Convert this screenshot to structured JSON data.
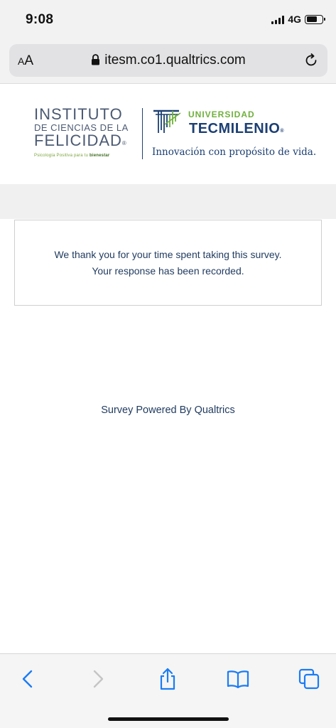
{
  "status_bar": {
    "time": "9:08",
    "network": "4G",
    "signal_bars_active": 4,
    "battery_level": 0.7
  },
  "address_bar": {
    "text_size_button": "AA",
    "url": "itesm.co1.qualtrics.com",
    "icons": [
      "lock-icon",
      "reload-icon"
    ]
  },
  "header": {
    "left_logo": {
      "line1": "INSTITUTO",
      "line2": "DE CIENCIAS DE LA",
      "line3": "FELICIDAD",
      "registered": "®",
      "subtitle_prefix": "Psicología Positiva para tu ",
      "subtitle_highlight": "bienestar"
    },
    "right_logo": {
      "university": "UNIVERSIDAD",
      "name": "TECMILENIO",
      "registered": "®",
      "tagline": "Innovación con propósito de vida."
    }
  },
  "survey": {
    "thanks_line1": "We thank you for your time spent taking this survey.",
    "thanks_line2": "Your response has been recorded.",
    "powered_by": "Survey Powered By Qualtrics"
  },
  "toolbar": {
    "items": [
      "back-icon",
      "forward-icon",
      "share-icon",
      "bookmarks-icon",
      "tabs-icon"
    ]
  },
  "colors": {
    "accent_blue": "#1a7cf5",
    "tec_navy": "#1c3f73",
    "tec_green": "#6fb03b",
    "text_navy": "#1f3a5f"
  }
}
